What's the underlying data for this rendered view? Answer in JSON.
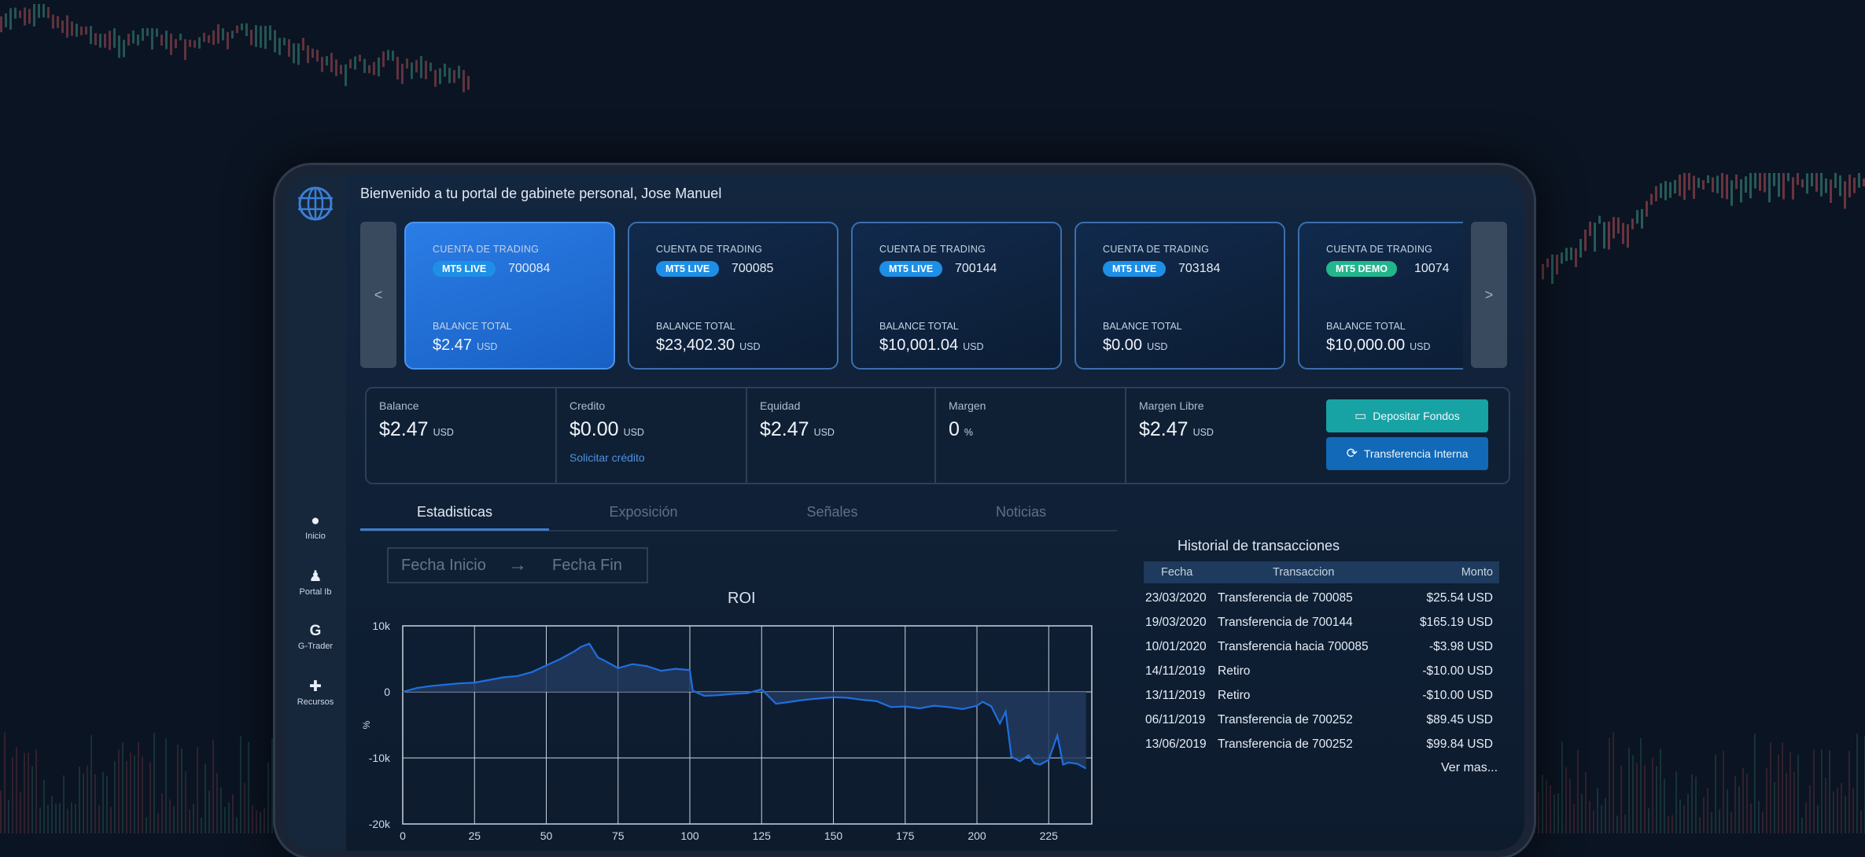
{
  "welcome": "Bienvenido a tu portal de gabinete personal, Jose Manuel",
  "sidebar": {
    "items": [
      {
        "label": "Inicio",
        "icon": "user-icon"
      },
      {
        "label": "Portal Ib",
        "icon": "person-icon"
      },
      {
        "label": "G-Trader",
        "icon": "g-trader-icon"
      },
      {
        "label": "Recursos",
        "icon": "puzzle-icon"
      }
    ]
  },
  "carousel": {
    "prev": "<",
    "next": ">",
    "cards": [
      {
        "type_label": "CUENTA DE TRADING",
        "badge": "MT5 LIVE",
        "number": "700084",
        "balance_label": "BALANCE TOTAL",
        "balance": "$2.47",
        "currency": "USD",
        "selected": true
      },
      {
        "type_label": "CUENTA DE TRADING",
        "badge": "MT5 LIVE",
        "number": "700085",
        "balance_label": "BALANCE TOTAL",
        "balance": "$23,402.30",
        "currency": "USD"
      },
      {
        "type_label": "CUENTA DE TRADING",
        "badge": "MT5 LIVE",
        "number": "700144",
        "balance_label": "BALANCE TOTAL",
        "balance": "$10,001.04",
        "currency": "USD"
      },
      {
        "type_label": "CUENTA DE TRADING",
        "badge": "MT5 LIVE",
        "number": "703184",
        "balance_label": "BALANCE TOTAL",
        "balance": "$0.00",
        "currency": "USD"
      },
      {
        "type_label": "CUENTA DE TRADING",
        "badge": "MT5 DEMO",
        "number": "10074",
        "balance_label": "BALANCE TOTAL",
        "balance": "$10,000.00",
        "currency": "USD"
      }
    ]
  },
  "stats": [
    {
      "label": "Balance",
      "value": "$2.47",
      "unit": "USD"
    },
    {
      "label": "Credito",
      "value": "$0.00",
      "unit": "USD",
      "link": "Solicitar crédito"
    },
    {
      "label": "Equidad",
      "value": "$2.47",
      "unit": "USD"
    },
    {
      "label": "Margen",
      "value": "0",
      "unit": "%"
    },
    {
      "label": "Margen Libre",
      "value": "$2.47",
      "unit": "USD"
    }
  ],
  "actions": {
    "deposit": "Depositar Fondos",
    "transfer": "Transferencia Interna"
  },
  "tabs": [
    "Estadisticas",
    "Exposición",
    "Señales",
    "Noticias"
  ],
  "date_range": {
    "start": "Fecha Inicio",
    "arrow": "→",
    "end": "Fecha Fin"
  },
  "history": {
    "title": "Historial de transacciones",
    "headers": [
      "Fecha",
      "Transaccion",
      "Monto"
    ],
    "rows": [
      [
        "23/03/2020",
        "Transferencia de 700085",
        "$25.54 USD"
      ],
      [
        "19/03/2020",
        "Transferencia de 700144",
        "$165.19 USD"
      ],
      [
        "10/01/2020",
        "Transferencia hacia 700085",
        "-$3.98 USD"
      ],
      [
        "14/11/2019",
        "Retiro",
        "-$10.00 USD"
      ],
      [
        "13/11/2019",
        "Retiro",
        "-$10.00 USD"
      ],
      [
        "06/11/2019",
        "Transferencia de 700252",
        "$89.45 USD"
      ],
      [
        "13/06/2019",
        "Transferencia de 700252",
        "$99.84 USD"
      ]
    ],
    "more": "Ver mas..."
  },
  "chart_data": {
    "type": "area",
    "title": "ROI",
    "xlabel": "",
    "ylabel": "%",
    "xlim": [
      0,
      240
    ],
    "ylim": [
      -20000,
      10000
    ],
    "x_ticks": [
      0,
      25,
      50,
      75,
      100,
      125,
      150,
      175,
      200,
      225
    ],
    "y_ticks": [
      {
        "v": 10000,
        "label": "10k"
      },
      {
        "v": 0,
        "label": "0"
      },
      {
        "v": -10000,
        "label": "-10k"
      },
      {
        "v": -20000,
        "label": "-20k"
      }
    ],
    "grid": true,
    "colors": {
      "line": "#1f6fe0",
      "fill": "#223a5e"
    },
    "x": [
      0,
      5,
      10,
      15,
      20,
      25,
      30,
      35,
      40,
      45,
      50,
      55,
      60,
      62,
      65,
      68,
      70,
      75,
      80,
      85,
      90,
      95,
      100,
      101,
      105,
      110,
      115,
      120,
      125,
      130,
      135,
      140,
      145,
      150,
      155,
      160,
      165,
      170,
      175,
      180,
      185,
      190,
      195,
      200,
      202,
      205,
      208,
      210,
      212,
      215,
      218,
      220,
      222,
      225,
      228,
      230,
      232,
      235,
      238
    ],
    "y": [
      0,
      600,
      900,
      1100,
      1300,
      1400,
      1800,
      2200,
      2400,
      3000,
      4000,
      5000,
      6200,
      6800,
      7300,
      5200,
      4800,
      3600,
      4200,
      3900,
      3200,
      3500,
      3300,
      200,
      -600,
      -500,
      -300,
      -200,
      400,
      -1800,
      -1500,
      -1200,
      -1000,
      -800,
      -900,
      -1200,
      -1400,
      -2300,
      -2200,
      -2500,
      -2100,
      -2300,
      -2600,
      -2100,
      -1500,
      -2200,
      -4800,
      -3000,
      -9800,
      -10500,
      -9600,
      -10800,
      -11000,
      -10300,
      -6600,
      -11000,
      -10700,
      -10900,
      -11600
    ]
  }
}
